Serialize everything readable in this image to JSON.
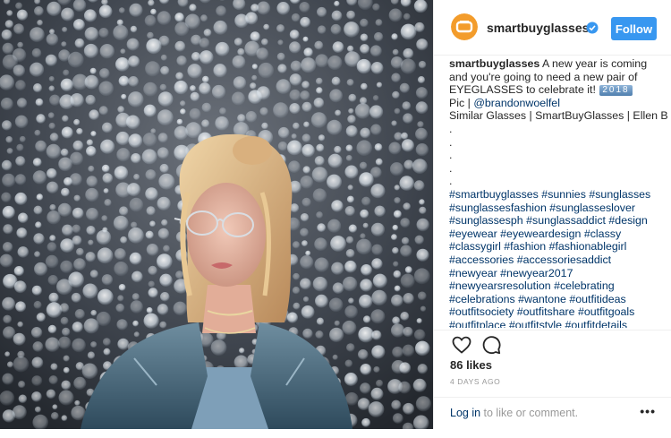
{
  "post": {
    "username": "smartbuyglasses",
    "follow_label": "Follow",
    "caption": {
      "author": "smartbuyglasses",
      "line1": "A new year is coming",
      "line2": "and you're going to need a new pair of",
      "line3": "EYEGLASSES to celebrate it!",
      "year_badge": "2018",
      "pic_prefix": "Pic | ",
      "pic_handle": "@brandonwoelfel",
      "similar": "Similar Glasses | SmartBuyGlasses | Ellen B",
      "dots": [
        ".",
        ".",
        ".",
        ".",
        "."
      ],
      "hashtag_lines": [
        "#smartbuyglasses #sunnies #sunglasses",
        "#sunglassesfashion #sunglasseslover",
        "#sunglassesph #sunglassaddict #design",
        "#eyewear #eyeweardesign #classy",
        "#classygirl #fashion #fashionablegirl",
        "#accessories #accessoriesaddict",
        "#newyear #newyear2017",
        "#newyearsresolution #celebrating",
        "#celebrations #wantone #outfitideas",
        "#outfitsociety #outfitshare #outfitgoals",
        "#outfitplace #outfitstyle #outfitdetails"
      ]
    },
    "likes": "86 likes",
    "timestamp": "4 DAYS AGO",
    "login_link": "Log in",
    "login_suffix": " to like or comment.",
    "more_label": "•••",
    "icons": {
      "like": "heart-icon",
      "comment": "comment-icon",
      "verified": "verified-badge-icon",
      "avatar": "brand-logo-avatar"
    },
    "colors": {
      "follow_button": "#3897f0",
      "link": "#003569",
      "muted": "#999999",
      "avatar_orange": "#f39c2b",
      "verified_blue": "#3897f0"
    }
  }
}
